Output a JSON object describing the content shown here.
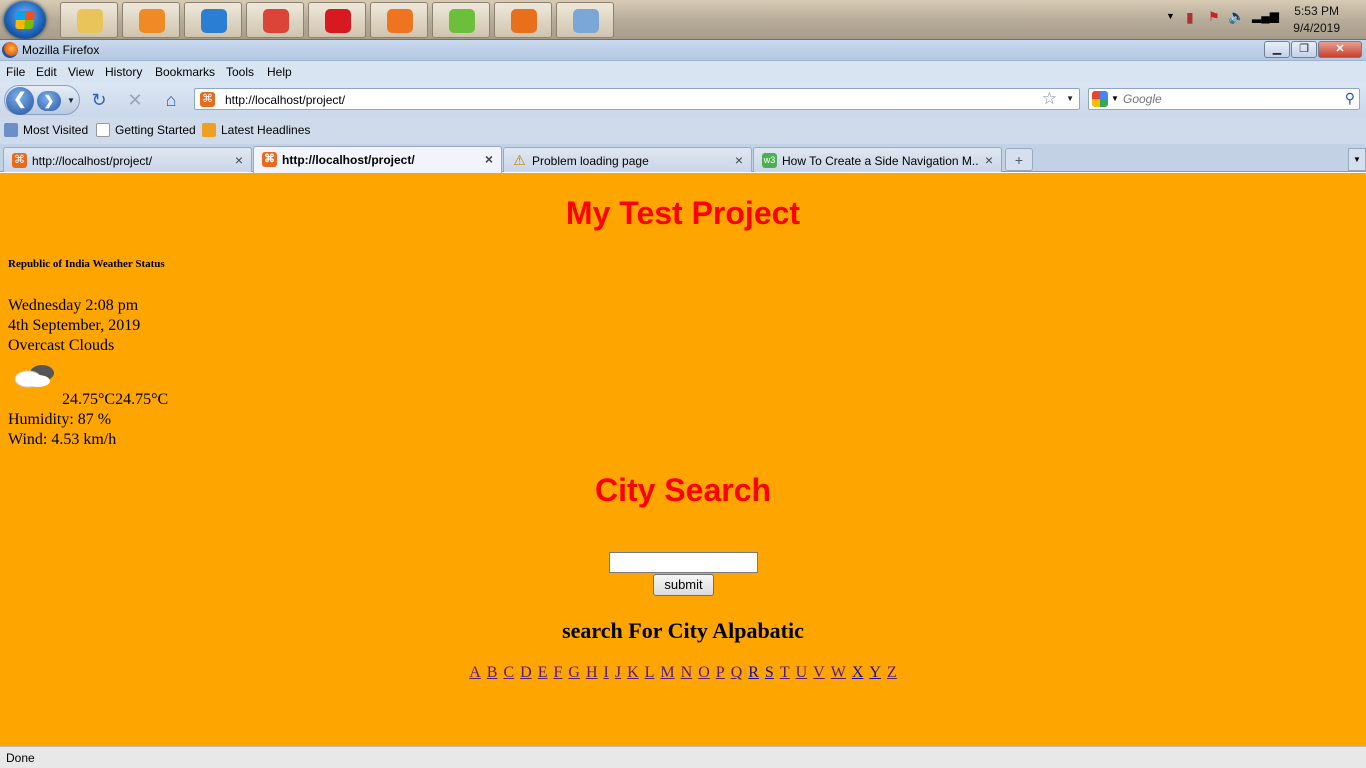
{
  "taskbar": {
    "apps": [
      {
        "name": "explorer",
        "color": "#e8c45a"
      },
      {
        "name": "media-player",
        "color": "#f08a24"
      },
      {
        "name": "internet-explorer",
        "color": "#2a7fd4"
      },
      {
        "name": "chrome",
        "color": "#db4437"
      },
      {
        "name": "opera",
        "color": "#d61a1f"
      },
      {
        "name": "xampp",
        "color": "#f0741f"
      },
      {
        "name": "notepad-plus",
        "color": "#6bbf3a"
      },
      {
        "name": "firefox",
        "color": "#e8701a"
      },
      {
        "name": "paint",
        "color": "#7aa6d8"
      }
    ],
    "clock_time": "5:53 PM",
    "clock_date": "9/4/2019"
  },
  "window": {
    "title": "Mozilla Firefox"
  },
  "menu": [
    "File",
    "Edit",
    "View",
    "History",
    "Bookmarks",
    "Tools",
    "Help"
  ],
  "nav": {
    "url": "http://localhost/project/",
    "search_placeholder": "Google"
  },
  "bookmarks": [
    "Most Visited",
    "Getting Started",
    "Latest Headlines"
  ],
  "tabs": [
    {
      "label": "http://localhost/project/",
      "active": false,
      "icon_color": "#e86a1d"
    },
    {
      "label": "http://localhost/project/",
      "active": true,
      "icon_color": "#e86a1d"
    },
    {
      "label": "Problem loading page",
      "active": false,
      "icon_color": "#e8c21a"
    },
    {
      "label": "How To Create a Side Navigation M...",
      "active": false,
      "icon_color": "#4caf50"
    }
  ],
  "page": {
    "heading": "My Test Project",
    "weather_heading": "Republic of India Weather Status",
    "day_time": "Wednesday 2:08 pm",
    "date": "4th September, 2019",
    "condition": "Overcast Clouds",
    "temperature": "24.75°C24.75°C",
    "humidity": "Humidity: 87 %",
    "wind": "Wind: 4.53 km/h",
    "city_search_heading": "City Search",
    "search_value": "",
    "submit_label": "submit",
    "alpha_heading": "search For City Alpabatic",
    "letters": [
      "A",
      "B",
      "C",
      "D",
      "E",
      "F",
      "G",
      "H",
      "I",
      "J",
      "K",
      "L",
      "M",
      "N",
      "O",
      "P",
      "Q",
      "R",
      "S",
      "T",
      "U",
      "V",
      "W",
      "X",
      "Y",
      "Z"
    ],
    "accent_color": "#ff0000",
    "background_color": "#ffa500"
  },
  "status": "Done"
}
